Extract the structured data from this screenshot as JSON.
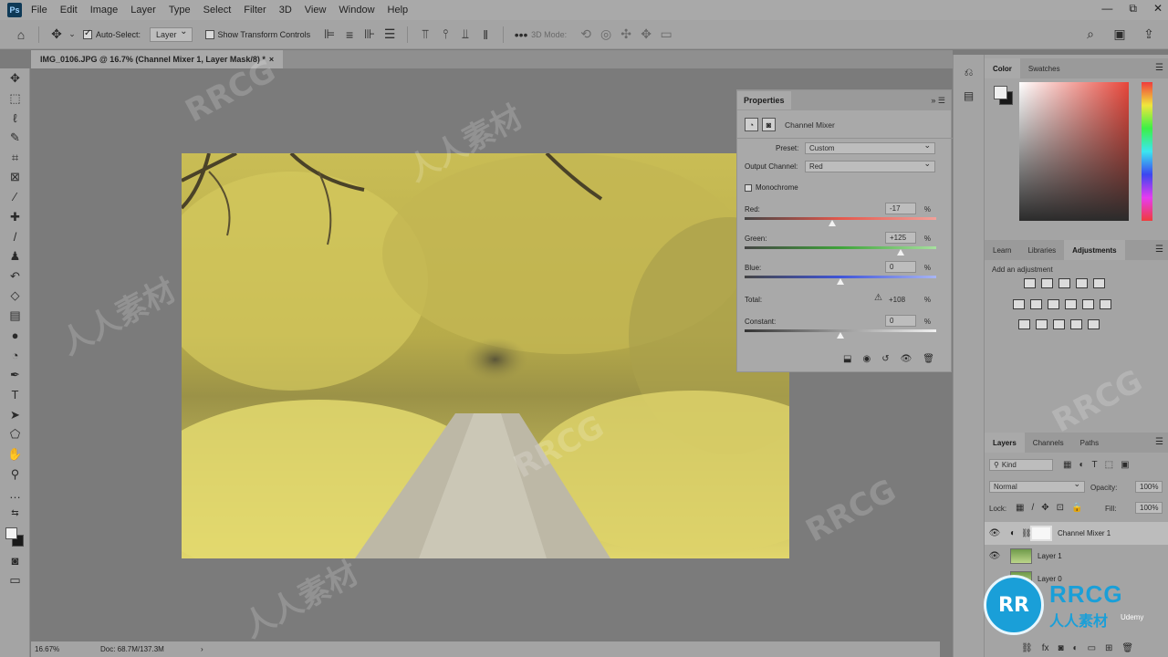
{
  "app": {
    "logo": "Ps",
    "menu": [
      "File",
      "Edit",
      "Image",
      "Layer",
      "Type",
      "Select",
      "Filter",
      "3D",
      "View",
      "Window",
      "Help"
    ],
    "window_controls": [
      "—",
      "⧉",
      "✕"
    ]
  },
  "options_bar": {
    "auto_select_label": "Auto-Select:",
    "auto_select_value": "Layer",
    "transform_controls_label": "Show Transform Controls",
    "mode_3d_label": "3D Mode:"
  },
  "document": {
    "tab_title": "IMG_0106.JPG @ 16.7% (Channel Mixer 1, Layer Mask/8) *",
    "tab_close": "×"
  },
  "status": {
    "zoom": "16.67%",
    "doc_size": "Doc: 68.7M/137.3M",
    "arrow": "›"
  },
  "properties": {
    "tab_label": "Properties",
    "header_label": "Channel Mixer",
    "preset_label": "Preset:",
    "preset_value": "Custom",
    "output_channel_label": "Output Channel:",
    "output_channel_value": "Red",
    "monochrome_label": "Monochrome",
    "red_label": "Red:",
    "red_value": "-17",
    "green_label": "Green:",
    "green_value": "+125",
    "blue_label": "Blue:",
    "blue_value": "0",
    "total_label": "Total:",
    "total_value": "+108",
    "constant_label": "Constant:",
    "constant_value": "0",
    "pct": "%",
    "slider_levels": {
      "red": -17,
      "green": 125,
      "blue": 0,
      "constant": 0,
      "range": [
        -200,
        200
      ]
    }
  },
  "color_panel": {
    "tabs": [
      "Color",
      "Swatches"
    ]
  },
  "adjustments_panel": {
    "tabs": [
      "Learn",
      "Libraries",
      "Adjustments"
    ],
    "add_label": "Add an adjustment"
  },
  "layers_panel": {
    "tabs": [
      "Layers",
      "Channels",
      "Paths"
    ],
    "filter_kind": "Kind",
    "blend_mode": "Normal",
    "opacity_label": "Opacity:",
    "opacity_value": "100%",
    "lock_label": "Lock:",
    "fill_label": "Fill:",
    "fill_value": "100%",
    "layers": [
      {
        "name": "Channel Mixer 1"
      },
      {
        "name": "Layer 1"
      },
      {
        "name": "Layer 0"
      }
    ]
  },
  "watermark": {
    "brand": "RRCG",
    "cn": "人人素材",
    "udemy": "Udemy"
  },
  "colors": {
    "accent": "#1a9fd8",
    "photo_yellow": "#d9cf6a"
  }
}
